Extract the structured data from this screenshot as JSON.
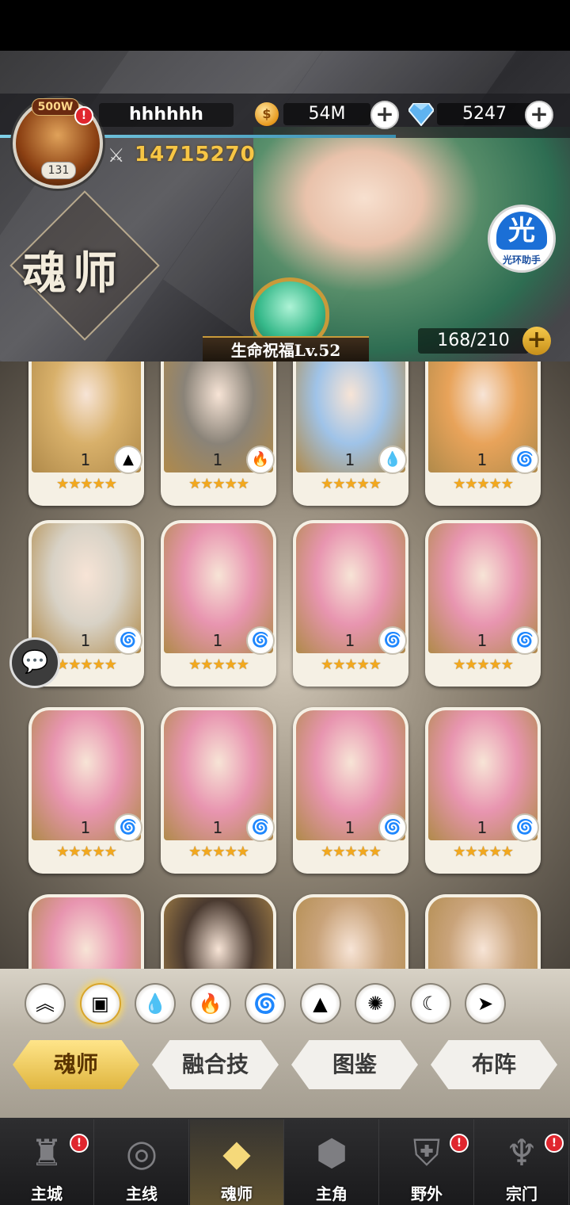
{
  "player": {
    "vip": "500W",
    "name": "hhhhhh",
    "level": "131",
    "power": "14715270",
    "coins": "54M",
    "gems": "5247",
    "alert": "!"
  },
  "page_title": "魂师",
  "helper": {
    "glyph": "光",
    "label": "光环助手"
  },
  "blessing": {
    "label": "生命祝福Lv.52"
  },
  "roster": {
    "count": "168/210"
  },
  "cards": [
    {
      "level": "1",
      "element": "earth-icon",
      "glyph": "▲",
      "stars": "★★★★★",
      "art": "#d8b06a"
    },
    {
      "level": "1",
      "element": "fire-icon",
      "glyph": "🔥",
      "stars": "★★★★★",
      "art": "#8a8378"
    },
    {
      "level": "1",
      "element": "water-icon",
      "glyph": "💧",
      "stars": "★★★★★",
      "art": "#9fc3e8"
    },
    {
      "level": "1",
      "element": "wind-icon",
      "glyph": "🌀",
      "stars": "★★★★★",
      "art": "#e8a35a"
    },
    {
      "level": "1",
      "element": "wind-icon",
      "glyph": "🌀",
      "stars": "★★★★★",
      "art": "#d8d2c6"
    },
    {
      "level": "1",
      "element": "wind-icon",
      "glyph": "🌀",
      "stars": "★★★★★",
      "art": "#e895b0"
    },
    {
      "level": "1",
      "element": "wind-icon",
      "glyph": "🌀",
      "stars": "★★★★★",
      "art": "#e895b0"
    },
    {
      "level": "1",
      "element": "wind-icon",
      "glyph": "🌀",
      "stars": "★★★★★",
      "art": "#e895b0"
    },
    {
      "level": "1",
      "element": "wind-icon",
      "glyph": "🌀",
      "stars": "★★★★★",
      "art": "#e895b0"
    },
    {
      "level": "1",
      "element": "wind-icon",
      "glyph": "🌀",
      "stars": "★★★★★",
      "art": "#e895b0"
    },
    {
      "level": "1",
      "element": "wind-icon",
      "glyph": "🌀",
      "stars": "★★★★★",
      "art": "#e895b0"
    },
    {
      "level": "1",
      "element": "wind-icon",
      "glyph": "🌀",
      "stars": "★★★★★",
      "art": "#e895b0"
    },
    {
      "level": "",
      "element": "",
      "glyph": "",
      "stars": "",
      "art": "#e895b0"
    },
    {
      "level": "",
      "element": "",
      "glyph": "",
      "stars": "",
      "art": "#4a3a30"
    },
    {
      "level": "",
      "element": "",
      "glyph": "",
      "stars": "",
      "art": "#c9a37a"
    },
    {
      "level": "",
      "element": "",
      "glyph": "",
      "stars": "",
      "art": "#c9a37a"
    }
  ],
  "filters": [
    {
      "name": "filter-up-icon",
      "glyph": "︽"
    },
    {
      "name": "filter-all-icon",
      "glyph": "▣"
    },
    {
      "name": "filter-water-icon",
      "glyph": "💧"
    },
    {
      "name": "filter-fire-icon",
      "glyph": "🔥"
    },
    {
      "name": "filter-wind-icon",
      "glyph": "🌀"
    },
    {
      "name": "filter-earth-icon",
      "glyph": "▲"
    },
    {
      "name": "filter-light-icon",
      "glyph": "✺"
    },
    {
      "name": "filter-dark-icon",
      "glyph": "☾"
    },
    {
      "name": "filter-special-icon",
      "glyph": "➤"
    }
  ],
  "tabs": [
    "魂师",
    "融合技",
    "图鉴",
    "布阵"
  ],
  "nav": [
    {
      "label": "主城",
      "glyph": "♜",
      "alert": "!"
    },
    {
      "label": "主线",
      "glyph": "◎",
      "alert": ""
    },
    {
      "label": "魂师",
      "glyph": "◆",
      "alert": ""
    },
    {
      "label": "主角",
      "glyph": "⬢",
      "alert": ""
    },
    {
      "label": "野外",
      "glyph": "⛨",
      "alert": "!"
    },
    {
      "label": "宗门",
      "glyph": "♆",
      "alert": "!"
    }
  ]
}
